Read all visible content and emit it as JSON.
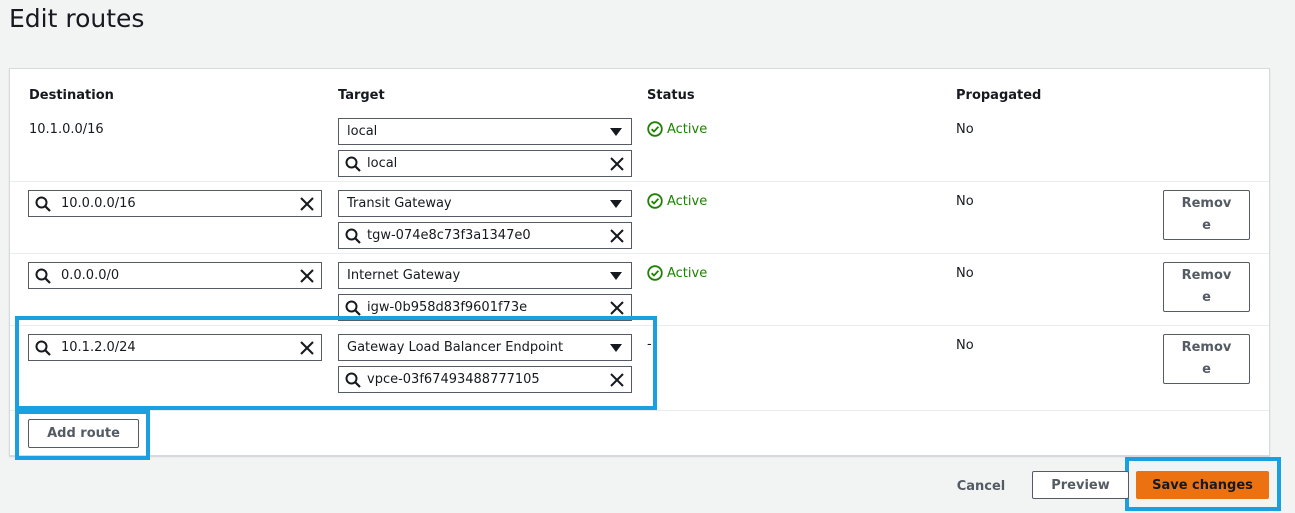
{
  "page": {
    "title": "Edit routes"
  },
  "columns": {
    "destination": "Destination",
    "target": "Target",
    "status": "Status",
    "propagated": "Propagated"
  },
  "routes": [
    {
      "destination": "10.1.0.0/16",
      "destination_editable": false,
      "target_type": "local",
      "target_id": "local",
      "status": "Active",
      "propagated": "No",
      "removable": false
    },
    {
      "destination": "10.0.0.0/16",
      "destination_editable": true,
      "target_type": "Transit Gateway",
      "target_id": "tgw-074e8c73f3a1347e0",
      "status": "Active",
      "propagated": "No",
      "removable": true,
      "remove_label": "Remove"
    },
    {
      "destination": "0.0.0.0/0",
      "destination_editable": true,
      "target_type": "Internet Gateway",
      "target_id": "igw-0b958d83f9601f73e",
      "status": "Active",
      "propagated": "No",
      "removable": true,
      "remove_label": "Remove"
    },
    {
      "destination": "10.1.2.0/24",
      "destination_editable": true,
      "target_type": "Gateway Load Balancer Endpoint",
      "target_id": "vpce-03f67493488777105",
      "status": "-",
      "propagated": "No",
      "removable": true,
      "remove_label": "Remove"
    }
  ],
  "actions": {
    "add_route": "Add route",
    "cancel": "Cancel",
    "preview": "Preview",
    "save": "Save changes"
  },
  "colors": {
    "status_active": "#1d8102",
    "primary_button": "#ec7211",
    "highlight": "#1a9fe0"
  },
  "icons": {
    "search": "search-icon",
    "clear": "close-icon",
    "dropdown": "caret-down-icon",
    "status_ok": "check-circle-icon"
  }
}
